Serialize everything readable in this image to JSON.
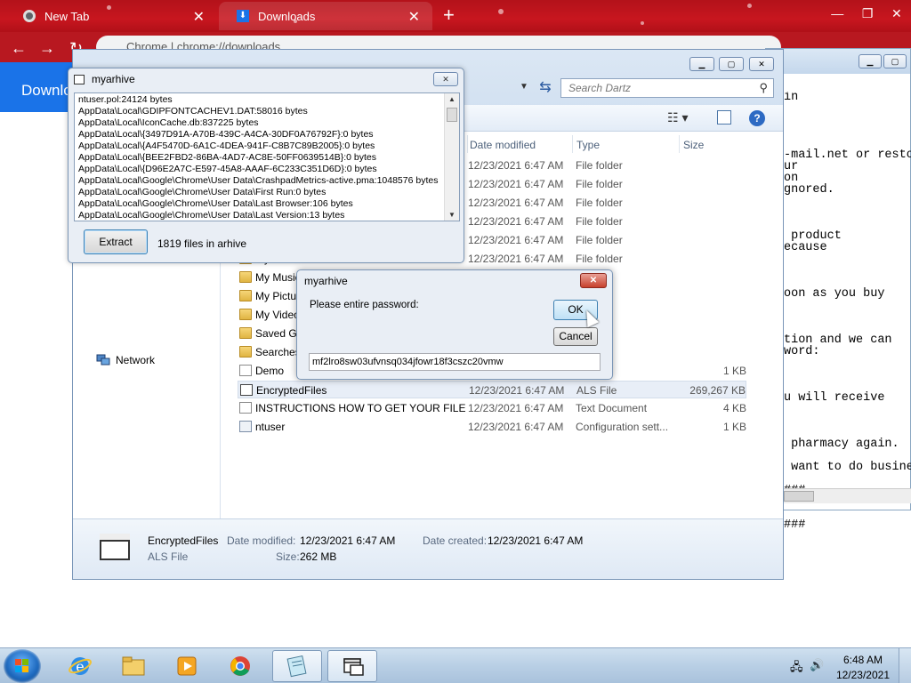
{
  "chrome": {
    "tabs": [
      {
        "label": "New Tab"
      },
      {
        "label": "Downloads"
      }
    ],
    "omnibox_text": "Chrome  |  chrome://downloads",
    "page_header": "Downlo"
  },
  "notepad": {
    "lines": [
      "in",
      "",
      "",
      "",
      "",
      "-mail.net or resto",
      "ur",
      "on",
      "gnored.",
      "",
      "",
      "",
      " product",
      "ecause",
      "",
      "",
      "",
      "oon as you buy",
      "",
      "",
      "",
      "tion and we can",
      "word:",
      "",
      "",
      "",
      "u will receive",
      "",
      "",
      "",
      " pharmacy again.",
      "",
      " want to do busine",
      "",
      "###",
      "",
      "",
      "###"
    ]
  },
  "explorer": {
    "search_placeholder": "Search Dartz",
    "columns": {
      "date": "Date modified",
      "type": "Type",
      "size": "Size"
    },
    "nav_pane": {
      "network": "Network"
    },
    "files": [
      {
        "name": "",
        "date": "12/23/2021 6:47 AM",
        "type": "File folder",
        "size": "",
        "icon": "folder-icon"
      },
      {
        "name": "",
        "date": "12/23/2021 6:47 AM",
        "type": "File folder",
        "size": "",
        "icon": "folder-icon"
      },
      {
        "name": "",
        "date": "12/23/2021 6:47 AM",
        "type": "File folder",
        "size": "",
        "icon": "folder-icon"
      },
      {
        "name": "",
        "date": "12/23/2021 6:47 AM",
        "type": "File folder",
        "size": "",
        "icon": "folder-icon"
      },
      {
        "name": "",
        "date": "12/23/2021 6:47 AM",
        "type": "File folder",
        "size": "",
        "icon": "folder-icon"
      },
      {
        "name": "My Documents",
        "date": "12/23/2021 6:47 AM",
        "type": "File folder",
        "size": "",
        "icon": "folder-icon"
      },
      {
        "name": "My Music",
        "date": "12/23/2021 6:47 AM",
        "type": "er",
        "size": "",
        "icon": "folder-icon"
      },
      {
        "name": "My Pictures",
        "date": "12/23/2021 6:47 AM",
        "type": "er",
        "size": "",
        "icon": "folder-icon"
      },
      {
        "name": "My Videos",
        "date": "12/23/2021 6:47 AM",
        "type": "er",
        "size": "",
        "icon": "folder-icon"
      },
      {
        "name": "Saved Games",
        "date": "12/23/2021 6:47 AM",
        "type": "er",
        "size": "",
        "icon": "folder-icon"
      },
      {
        "name": "Searches",
        "date": "12/23/2021 6:47 AM",
        "type": "er",
        "size": "",
        "icon": "folder-icon"
      },
      {
        "name": "Demo",
        "date": "",
        "type": "",
        "size": "1 KB",
        "icon": "document-icon"
      },
      {
        "name": "EncryptedFiles",
        "date": "12/23/2021 6:47 AM",
        "type": "ALS File",
        "size": "269,267 KB",
        "icon": "als-file-icon"
      },
      {
        "name": "INSTRUCTIONS HOW TO GET YOUR FILE...",
        "date": "12/23/2021 6:47 AM",
        "type": "Text Document",
        "size": "4 KB",
        "icon": "document-icon"
      },
      {
        "name": "ntuser",
        "date": "12/23/2021 6:47 AM",
        "type": "Configuration sett...",
        "size": "1 KB",
        "icon": "config-file-icon"
      }
    ],
    "details": {
      "name": "EncryptedFiles",
      "type": "ALS File",
      "date_modified_label": "Date modified:",
      "date_modified": "12/23/2021 6:47 AM",
      "date_created_label": "Date created:",
      "date_created": "12/23/2021 6:47 AM",
      "size_label": "Size:",
      "size": "262 MB"
    }
  },
  "archive_window": {
    "title": "myarhive",
    "entries": [
      "ntuser.pol:24124 bytes",
      "AppData\\Local\\GDIPFONTCACHEV1.DAT:58016 bytes",
      "AppData\\Local\\IconCache.db:837225 bytes",
      "AppData\\Local\\{3497D91A-A70B-439C-A4CA-30DF0A76792F}:0 bytes",
      "AppData\\Local\\{A4F5470D-6A1C-4DEA-941F-C8B7C89B2005}:0 bytes",
      "AppData\\Local\\{BEE2FBD2-86BA-4AD7-AC8E-50FF0639514B}:0 bytes",
      "AppData\\Local\\{D96E2A7C-E597-45A8-AAAF-6C233C351D6D}:0 bytes",
      "AppData\\Local\\Google\\Chrome\\User Data\\CrashpadMetrics-active.pma:1048576 bytes",
      "AppData\\Local\\Google\\Chrome\\User Data\\First Run:0 bytes",
      "AppData\\Local\\Google\\Chrome\\User Data\\Last Browser:106 bytes",
      "AppData\\Local\\Google\\Chrome\\User Data\\Last Version:13 bytes"
    ],
    "extract_label": "Extract",
    "file_count": "1819 files in arhive"
  },
  "password_dialog": {
    "title": "myarhive",
    "prompt": "Please entire password:",
    "ok_label": "OK",
    "cancel_label": "Cancel",
    "password_value": "mf2lro8sw03ufvnsq034jfowr18f3cszc20vmw"
  },
  "taskbar": {
    "items": [
      "internet-explorer",
      "windows-explorer",
      "media-player",
      "chrome",
      "notepad",
      "myarhive"
    ],
    "clock_time": "6:48 AM",
    "clock_date": "12/23/2021"
  },
  "colors": {
    "chrome_red": "#c8161f",
    "chrome_blue": "#1a73e8",
    "selection": "#e8eef7",
    "close_red": "#c7402c"
  }
}
